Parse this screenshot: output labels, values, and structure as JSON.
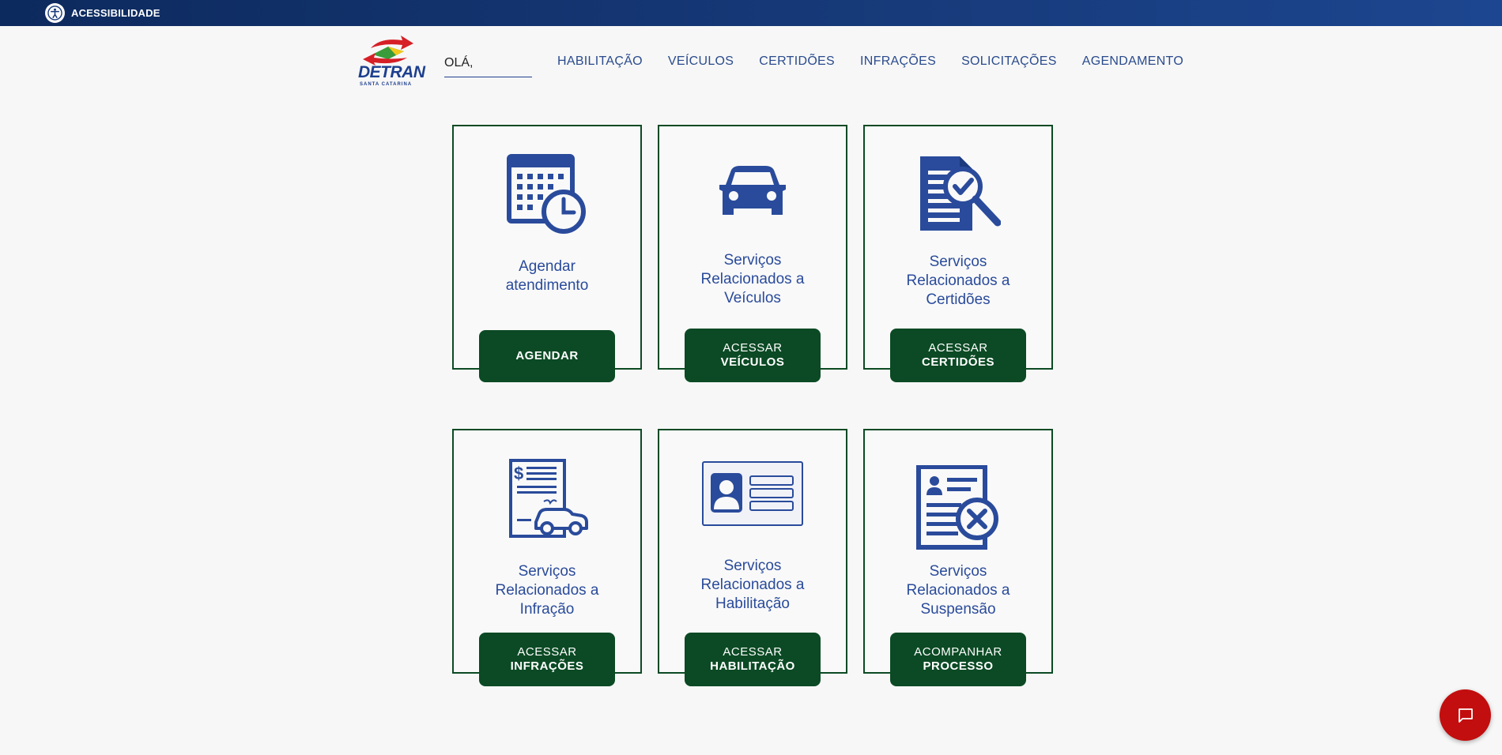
{
  "topbar": {
    "accessibility_label": "ACESSIBILIDADE"
  },
  "header": {
    "logo_text": "DETRAN",
    "logo_subtext": "SANTA CATARINA",
    "greeting": "OLÁ,",
    "nav": [
      "HABILITAÇÃO",
      "VEÍCULOS",
      "CERTIDÕES",
      "INFRAÇÕES",
      "SOLICITAÇÕES",
      "AGENDAMENTO"
    ]
  },
  "cards": [
    {
      "title": [
        "Agendar",
        "atendimento"
      ],
      "button": [
        "AGENDAR"
      ],
      "icon": "calendar-clock-icon"
    },
    {
      "title": [
        "Serviços",
        "Relacionados a",
        "Veículos"
      ],
      "button": [
        "ACESSAR",
        "VEÍCULOS"
      ],
      "icon": "car-icon"
    },
    {
      "title": [
        "Serviços",
        "Relacionados a",
        "Certidões"
      ],
      "button": [
        "ACESSAR",
        "CERTIDÕES"
      ],
      "icon": "document-search-icon"
    },
    {
      "title": [
        "Serviços",
        "Relacionados a",
        "Infração"
      ],
      "button": [
        "ACESSAR",
        "INFRAÇÕES"
      ],
      "icon": "fine-ticket-icon"
    },
    {
      "title": [
        "Serviços",
        "Relacionados a",
        "Habilitação"
      ],
      "button": [
        "ACESSAR",
        "HABILITAÇÃO"
      ],
      "icon": "id-card-icon"
    },
    {
      "title": [
        "Serviços",
        "Relacionados a",
        "Suspensão"
      ],
      "button": [
        "ACOMPANHAR",
        "PROCESSO"
      ],
      "icon": "document-cancel-icon"
    }
  ],
  "colors": {
    "brand_blue": "#2a4b9b",
    "brand_green": "#0b4a24",
    "chat_red": "#c20e0e"
  },
  "chat": {
    "icon": "chat-bubble-icon"
  }
}
